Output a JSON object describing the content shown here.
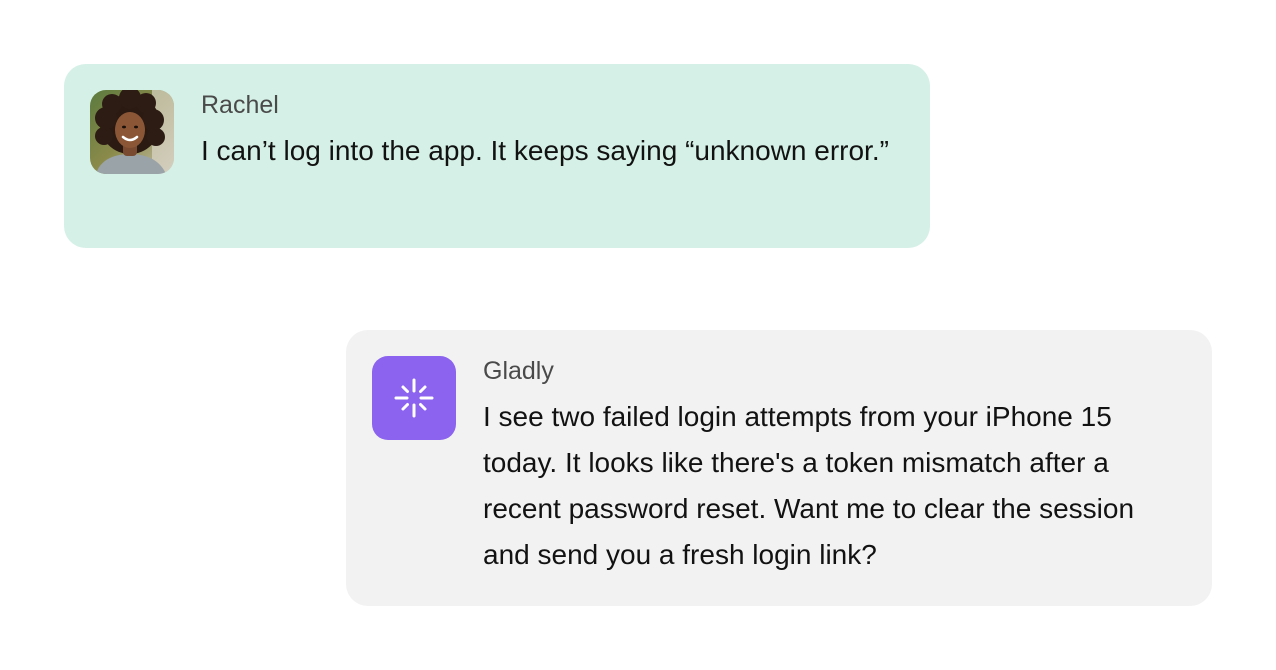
{
  "messages": {
    "user": {
      "sender": "Rachel",
      "text": "I can’t log into the app. It keeps saying “unknown error.”",
      "avatar_icon": "user-avatar-photo",
      "bubble_color": "#d5f0e6"
    },
    "agent": {
      "sender": "Gladly",
      "text": "I see two failed login attempts from your iPhone 15 today. It looks like there's a token mismatch after a recent password reset. Want me to clear the session and send you a fresh login link?",
      "logo_icon": "sparkle-icon",
      "logo_color": "#8b63ee",
      "bubble_color": "#f2f2f2"
    }
  }
}
